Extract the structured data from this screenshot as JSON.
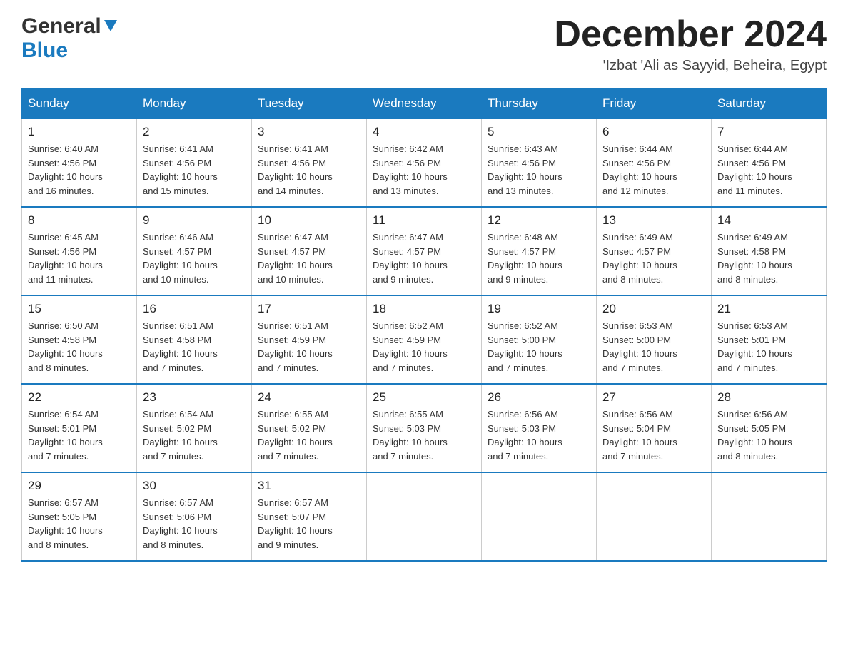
{
  "header": {
    "logo_general": "General",
    "logo_blue": "Blue",
    "month_title": "December 2024",
    "location": "'Izbat 'Ali as Sayyid, Beheira, Egypt"
  },
  "weekdays": [
    "Sunday",
    "Monday",
    "Tuesday",
    "Wednesday",
    "Thursday",
    "Friday",
    "Saturday"
  ],
  "weeks": [
    [
      {
        "day": "1",
        "sunrise": "6:40 AM",
        "sunset": "4:56 PM",
        "daylight": "10 hours and 16 minutes."
      },
      {
        "day": "2",
        "sunrise": "6:41 AM",
        "sunset": "4:56 PM",
        "daylight": "10 hours and 15 minutes."
      },
      {
        "day": "3",
        "sunrise": "6:41 AM",
        "sunset": "4:56 PM",
        "daylight": "10 hours and 14 minutes."
      },
      {
        "day": "4",
        "sunrise": "6:42 AM",
        "sunset": "4:56 PM",
        "daylight": "10 hours and 13 minutes."
      },
      {
        "day": "5",
        "sunrise": "6:43 AM",
        "sunset": "4:56 PM",
        "daylight": "10 hours and 13 minutes."
      },
      {
        "day": "6",
        "sunrise": "6:44 AM",
        "sunset": "4:56 PM",
        "daylight": "10 hours and 12 minutes."
      },
      {
        "day": "7",
        "sunrise": "6:44 AM",
        "sunset": "4:56 PM",
        "daylight": "10 hours and 11 minutes."
      }
    ],
    [
      {
        "day": "8",
        "sunrise": "6:45 AM",
        "sunset": "4:56 PM",
        "daylight": "10 hours and 11 minutes."
      },
      {
        "day": "9",
        "sunrise": "6:46 AM",
        "sunset": "4:57 PM",
        "daylight": "10 hours and 10 minutes."
      },
      {
        "day": "10",
        "sunrise": "6:47 AM",
        "sunset": "4:57 PM",
        "daylight": "10 hours and 10 minutes."
      },
      {
        "day": "11",
        "sunrise": "6:47 AM",
        "sunset": "4:57 PM",
        "daylight": "10 hours and 9 minutes."
      },
      {
        "day": "12",
        "sunrise": "6:48 AM",
        "sunset": "4:57 PM",
        "daylight": "10 hours and 9 minutes."
      },
      {
        "day": "13",
        "sunrise": "6:49 AM",
        "sunset": "4:57 PM",
        "daylight": "10 hours and 8 minutes."
      },
      {
        "day": "14",
        "sunrise": "6:49 AM",
        "sunset": "4:58 PM",
        "daylight": "10 hours and 8 minutes."
      }
    ],
    [
      {
        "day": "15",
        "sunrise": "6:50 AM",
        "sunset": "4:58 PM",
        "daylight": "10 hours and 8 minutes."
      },
      {
        "day": "16",
        "sunrise": "6:51 AM",
        "sunset": "4:58 PM",
        "daylight": "10 hours and 7 minutes."
      },
      {
        "day": "17",
        "sunrise": "6:51 AM",
        "sunset": "4:59 PM",
        "daylight": "10 hours and 7 minutes."
      },
      {
        "day": "18",
        "sunrise": "6:52 AM",
        "sunset": "4:59 PM",
        "daylight": "10 hours and 7 minutes."
      },
      {
        "day": "19",
        "sunrise": "6:52 AM",
        "sunset": "5:00 PM",
        "daylight": "10 hours and 7 minutes."
      },
      {
        "day": "20",
        "sunrise": "6:53 AM",
        "sunset": "5:00 PM",
        "daylight": "10 hours and 7 minutes."
      },
      {
        "day": "21",
        "sunrise": "6:53 AM",
        "sunset": "5:01 PM",
        "daylight": "10 hours and 7 minutes."
      }
    ],
    [
      {
        "day": "22",
        "sunrise": "6:54 AM",
        "sunset": "5:01 PM",
        "daylight": "10 hours and 7 minutes."
      },
      {
        "day": "23",
        "sunrise": "6:54 AM",
        "sunset": "5:02 PM",
        "daylight": "10 hours and 7 minutes."
      },
      {
        "day": "24",
        "sunrise": "6:55 AM",
        "sunset": "5:02 PM",
        "daylight": "10 hours and 7 minutes."
      },
      {
        "day": "25",
        "sunrise": "6:55 AM",
        "sunset": "5:03 PM",
        "daylight": "10 hours and 7 minutes."
      },
      {
        "day": "26",
        "sunrise": "6:56 AM",
        "sunset": "5:03 PM",
        "daylight": "10 hours and 7 minutes."
      },
      {
        "day": "27",
        "sunrise": "6:56 AM",
        "sunset": "5:04 PM",
        "daylight": "10 hours and 7 minutes."
      },
      {
        "day": "28",
        "sunrise": "6:56 AM",
        "sunset": "5:05 PM",
        "daylight": "10 hours and 8 minutes."
      }
    ],
    [
      {
        "day": "29",
        "sunrise": "6:57 AM",
        "sunset": "5:05 PM",
        "daylight": "10 hours and 8 minutes."
      },
      {
        "day": "30",
        "sunrise": "6:57 AM",
        "sunset": "5:06 PM",
        "daylight": "10 hours and 8 minutes."
      },
      {
        "day": "31",
        "sunrise": "6:57 AM",
        "sunset": "5:07 PM",
        "daylight": "10 hours and 9 minutes."
      },
      null,
      null,
      null,
      null
    ]
  ],
  "labels": {
    "sunrise": "Sunrise:",
    "sunset": "Sunset:",
    "daylight": "Daylight:"
  }
}
